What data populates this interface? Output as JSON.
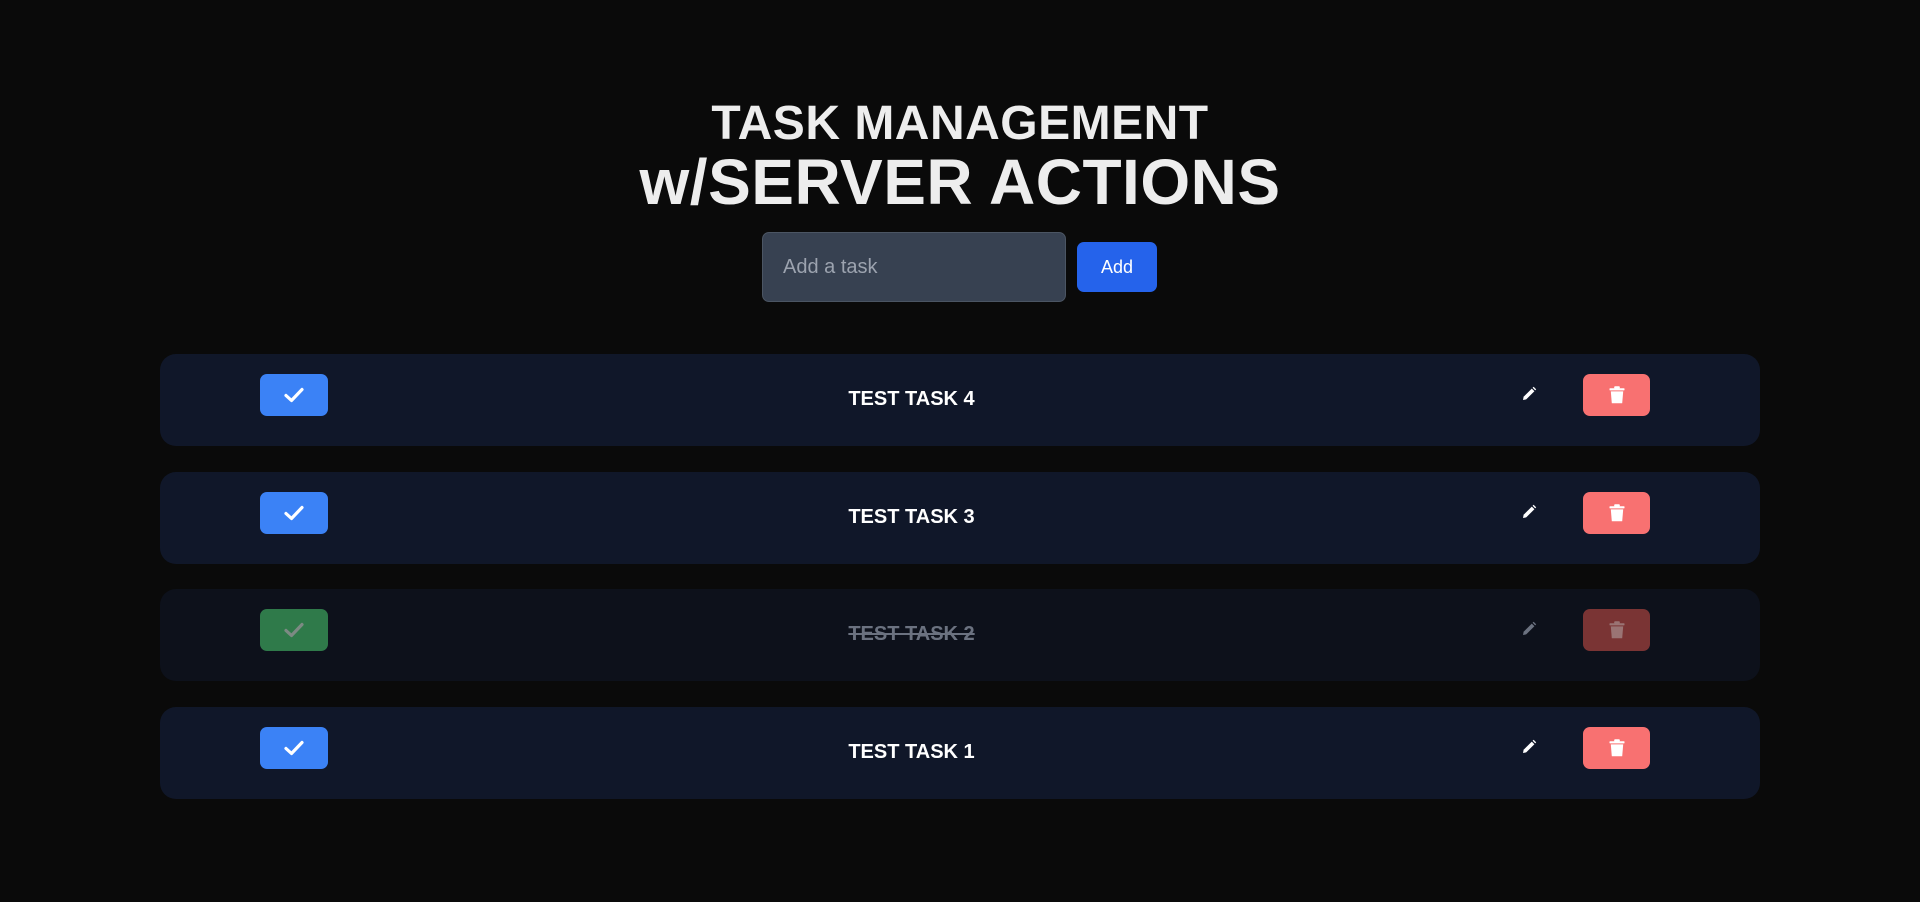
{
  "header": {
    "title_line1": "TASK MANAGEMENT",
    "title_line2": "w/SERVER ACTIONS"
  },
  "add_form": {
    "input_value": "",
    "input_placeholder": "Add a task",
    "add_label": "Add"
  },
  "tasks": [
    {
      "label": "TEST TASK 4",
      "completed": false
    },
    {
      "label": "TEST TASK 3",
      "completed": false
    },
    {
      "label": "TEST TASK 2",
      "completed": true
    },
    {
      "label": "TEST TASK 1",
      "completed": false
    }
  ],
  "icons": {
    "check": "check-icon",
    "edit": "pencil-icon",
    "delete": "trash-icon"
  },
  "colors": {
    "background": "#0a0a0a",
    "row": "#101729",
    "row_completed": "#0d111b",
    "check_active": "#3b82f6",
    "check_done": "#2f7a4a",
    "delete": "#f87171",
    "delete_done": "#7a3434",
    "add_button": "#2563eb"
  }
}
